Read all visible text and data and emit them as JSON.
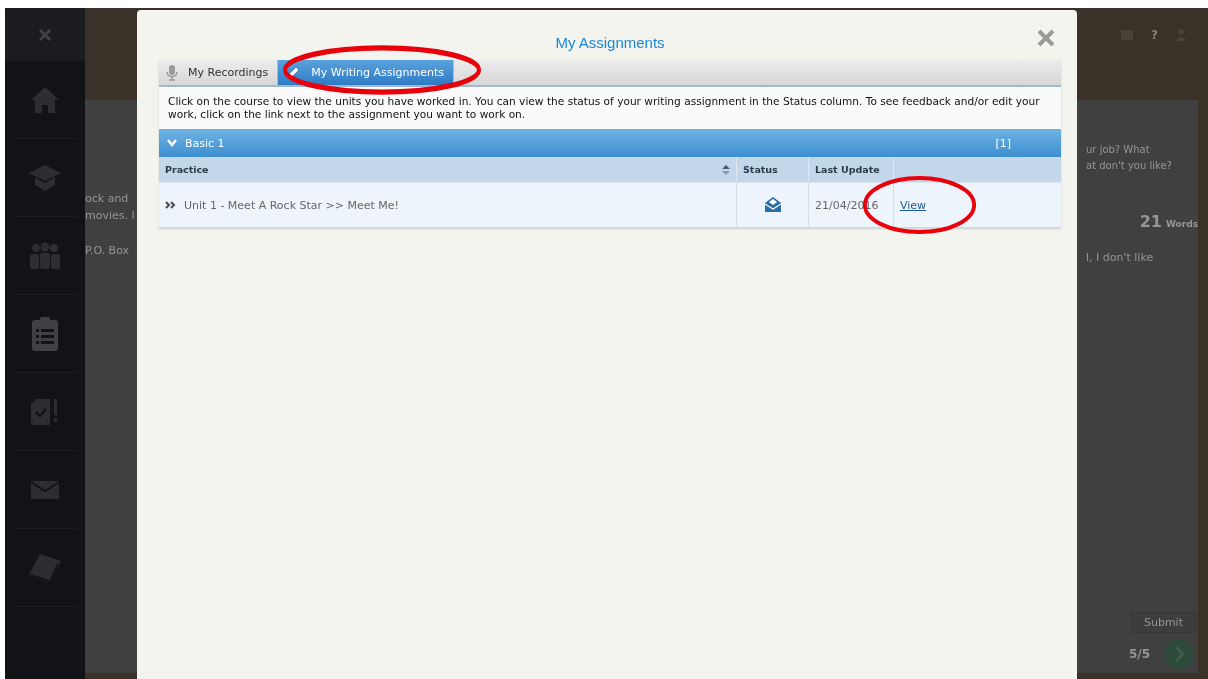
{
  "background_page": {
    "header_help": "?",
    "left_fragments": [
      "ock and",
      "movies. I",
      "P.O. Box"
    ],
    "question": [
      "ur job? What",
      "at don't you like?"
    ],
    "word_count": "21",
    "word_unit": "Words",
    "answer": "l, I don't like",
    "submit": "Submit",
    "page_counter": "5/5"
  },
  "dialog": {
    "title": "My Assignments",
    "tabs": [
      {
        "label": "My Recordings",
        "kind": "recordings",
        "selected": false
      },
      {
        "label": "My Writing Assignments",
        "kind": "writing",
        "selected": true
      }
    ],
    "instructions": "Click on the course to view the units you have worked in. You can view the status of your writing assignment in the Status column. To see feedback and/or edit your work, click on the link next to the assignment you want to work on.",
    "group": {
      "title": "Basic 1",
      "count": "[1]",
      "expanded": true
    },
    "columns": [
      "Practice",
      "Status",
      "Last Update"
    ],
    "rows": [
      {
        "practice": "Unit 1 - Meet A Rock Star >> Meet Me!",
        "kind": "submitted",
        "last_update": "21/04/2016",
        "action": "View"
      }
    ]
  }
}
